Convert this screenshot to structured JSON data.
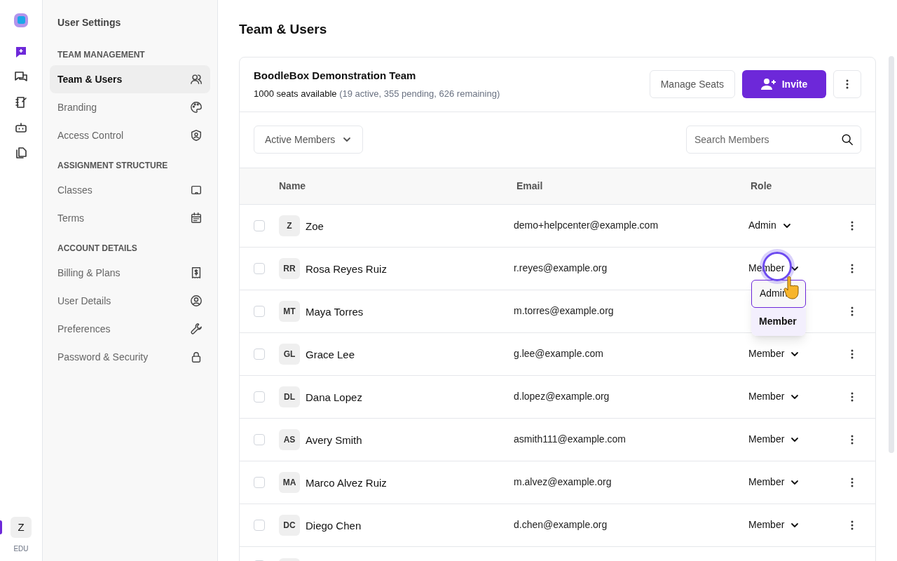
{
  "rail": {
    "items": [
      {
        "selected": true
      },
      {
        "selected": false
      },
      {
        "selected": false
      },
      {
        "selected": false
      },
      {
        "selected": false
      }
    ],
    "avatar": "Z",
    "plan": "EDU"
  },
  "sidebar": {
    "title": "User Settings",
    "sections": [
      {
        "heading": "TEAM MANAGEMENT",
        "items": [
          {
            "label": "Team & Users",
            "selected": true
          },
          {
            "label": "Branding",
            "selected": false
          },
          {
            "label": "Access Control",
            "selected": false
          }
        ]
      },
      {
        "heading": "ASSIGNMENT STRUCTURE",
        "items": [
          {
            "label": "Classes",
            "selected": false
          },
          {
            "label": "Terms",
            "selected": false
          }
        ]
      },
      {
        "heading": "ACCOUNT DETAILS",
        "items": [
          {
            "label": "Billing & Plans",
            "selected": false
          },
          {
            "label": "User Details",
            "selected": false
          },
          {
            "label": "Preferences",
            "selected": false
          },
          {
            "label": "Password & Security",
            "selected": false
          }
        ]
      }
    ]
  },
  "page_title": "Team & Users",
  "team": {
    "name": "BoodleBox Demonstration Team",
    "seats": "1000 seats available",
    "seat_detail": "(19 active, 355 pending, 626 remaining)",
    "buttons": [
      "Manage Seats",
      "Invite"
    ]
  },
  "filter": "Active Members",
  "search": {
    "placeholder": "Search Members"
  },
  "table": {
    "columns": [
      "Name",
      "Email",
      "Role"
    ],
    "rows": [
      {
        "initials": "Z",
        "name": "Zoe",
        "email": "demo+helpcenter@example.com",
        "role": "Admin",
        "checked": false
      },
      {
        "initials": "RR",
        "name": "Rosa Reyes Ruiz",
        "email": "r.reyes@example.org",
        "role": "Member",
        "checked": false,
        "menu": [
          {
            "label": "Admin",
            "hovered": true,
            "selected": false
          },
          {
            "label": "Member",
            "hovered": false,
            "selected": true
          }
        ]
      },
      {
        "initials": "MT",
        "name": "Maya Torres",
        "email": "m.torres@example.org",
        "checked": false
      },
      {
        "initials": "GL",
        "name": "Grace Lee",
        "email": "g.lee@example.com",
        "role": "Member",
        "checked": false
      },
      {
        "initials": "DL",
        "name": "Dana Lopez",
        "email": "d.lopez@example.org",
        "role": "Member",
        "checked": false
      },
      {
        "initials": "AS",
        "name": "Avery Smith",
        "email": "asmith111@example.com",
        "role": "Member",
        "checked": false
      },
      {
        "initials": "MA",
        "name": "Marco Alvez Ruiz",
        "email": "m.alvez@example.org",
        "role": "Member",
        "checked": false
      },
      {
        "initials": "DC",
        "name": "Diego Chen",
        "email": "d.chen@example.org",
        "role": "Member",
        "checked": false
      }
    ],
    "partial_row": {
      "checked": false
    }
  }
}
